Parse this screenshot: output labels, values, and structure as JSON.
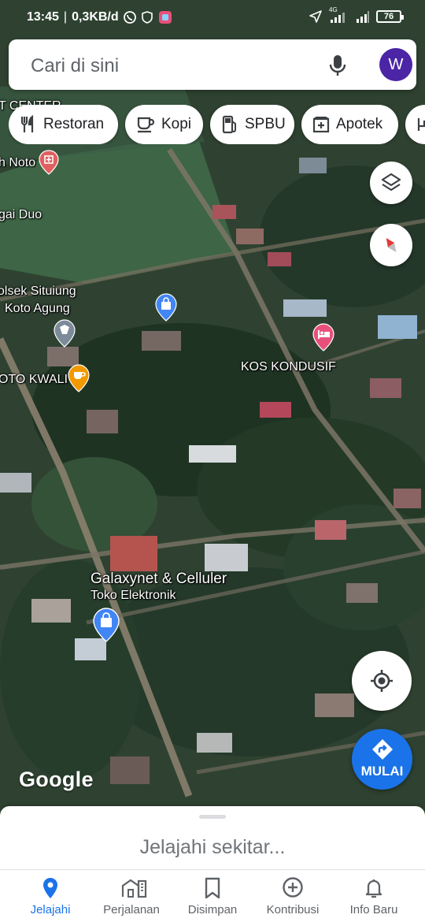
{
  "status_bar": {
    "time": "13:45",
    "network_speed": "0,3KB/d",
    "signal_label": "4G",
    "battery": "76"
  },
  "search": {
    "placeholder": "Cari di sini",
    "avatar_letter": "W"
  },
  "chips": [
    {
      "label": "Restoran",
      "icon": "fork-knife-icon"
    },
    {
      "label": "Kopi",
      "icon": "coffee-cup-icon"
    },
    {
      "label": "SPBU",
      "icon": "gas-station-icon"
    },
    {
      "label": "Apotek",
      "icon": "pharmacy-icon"
    }
  ],
  "map": {
    "labels": {
      "t_center": "T CENTER",
      "h_noto": "h Noto",
      "gai_duo": "gai Duo",
      "polsek_1": "olsek Situiung",
      "polsek_2": "Koto Agung",
      "oto_kwali": "OTO KWALI",
      "kos_kondusif": "KOS KONDUSIF",
      "galaxynet": "Galaxynet & Celluler",
      "toko_elektronik": "Toko Elektronik"
    },
    "watermark": "Google"
  },
  "actions": {
    "start_label": "MULAI"
  },
  "sheet": {
    "title": "Jelajahi sekitar..."
  },
  "nav": [
    {
      "label": "Jelajahi",
      "icon": "location-pin-icon",
      "active": true
    },
    {
      "label": "Perjalanan",
      "icon": "commute-icon",
      "active": false
    },
    {
      "label": "Disimpan",
      "icon": "bookmark-icon",
      "active": false
    },
    {
      "label": "Kontribusi",
      "icon": "add-circle-icon",
      "active": false
    },
    {
      "label": "Info Baru",
      "icon": "bell-icon",
      "active": false
    }
  ],
  "colors": {
    "accent": "#1a73e8",
    "avatar": "#4b25a5",
    "pin_blue": "#4285f4",
    "pin_pink": "#e8507b",
    "pin_orange": "#f29900",
    "pin_gray": "#7c8a99",
    "pin_red": "#e06060"
  }
}
